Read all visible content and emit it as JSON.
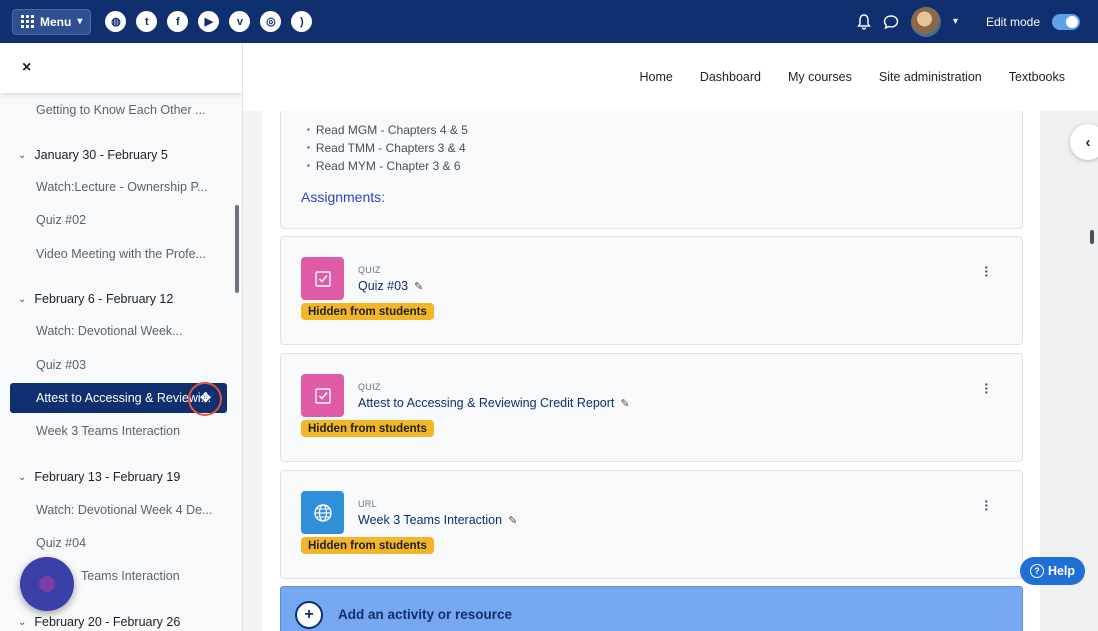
{
  "topbar": {
    "menu_label": "Menu",
    "social_icons": [
      "globe-icon",
      "twitter-icon",
      "facebook-icon",
      "youtube-icon",
      "vimeo-icon",
      "instagram-icon",
      "rss-icon"
    ],
    "edit_mode_label": "Edit mode",
    "edit_mode_on": true
  },
  "drawer": {
    "close_glyph": "×",
    "items": [
      {
        "kind": "item",
        "label": "Getting to Know Each Other ..."
      },
      {
        "kind": "section",
        "label": "January 30 - February 5"
      },
      {
        "kind": "item",
        "label": "Watch:Lecture - Ownership P..."
      },
      {
        "kind": "item",
        "label": "Quiz #02"
      },
      {
        "kind": "item",
        "label": "Video Meeting with the Profe..."
      },
      {
        "kind": "section",
        "label": "February 6 - February 12"
      },
      {
        "kind": "item",
        "label": "Watch: Devotional Week..."
      },
      {
        "kind": "item",
        "label": "Quiz #03"
      },
      {
        "kind": "active",
        "label": "Attest to Accessing & Reviewi..."
      },
      {
        "kind": "item",
        "label": "Week 3 Teams Interaction"
      },
      {
        "kind": "section",
        "label": "February 13 - February 19"
      },
      {
        "kind": "item",
        "label": "Watch: Devotional Week 4 De..."
      },
      {
        "kind": "item",
        "label": "Quiz #04"
      },
      {
        "kind": "item",
        "label": "Teams Interaction"
      },
      {
        "kind": "section",
        "label": "February 20 - February 26"
      }
    ]
  },
  "subnav": {
    "links": [
      "Home",
      "Dashboard",
      "My courses",
      "Site administration",
      "Textbooks"
    ]
  },
  "summary": {
    "readings": [
      "Read MGM - Chapters 4 & 5",
      "Read TMM - Chapters 3 & 4",
      "Read MYM - Chapter 3 & 6"
    ],
    "assignments_label": "Assignments:"
  },
  "activities": [
    {
      "type": "QUIZ",
      "title": "Quiz #03",
      "badge": "Hidden from students",
      "icon": "quiz-icon"
    },
    {
      "type": "QUIZ",
      "title": "Attest to Accessing & Reviewing Credit Report",
      "badge": "Hidden from students",
      "icon": "quiz-icon"
    },
    {
      "type": "URL",
      "title": "Week 3 Teams Interaction",
      "badge": "Hidden from students",
      "icon": "globe-icon"
    }
  ],
  "add_activity_label": "Add an activity or resource",
  "help_label": "Help",
  "colors": {
    "navbar": "#0f2f6e",
    "quiz_icon": "#e05aa5",
    "url_icon": "#2f8fd8",
    "badge": "#f3b626",
    "add_bar": "#75a8f0",
    "help": "#1f6fd6"
  }
}
